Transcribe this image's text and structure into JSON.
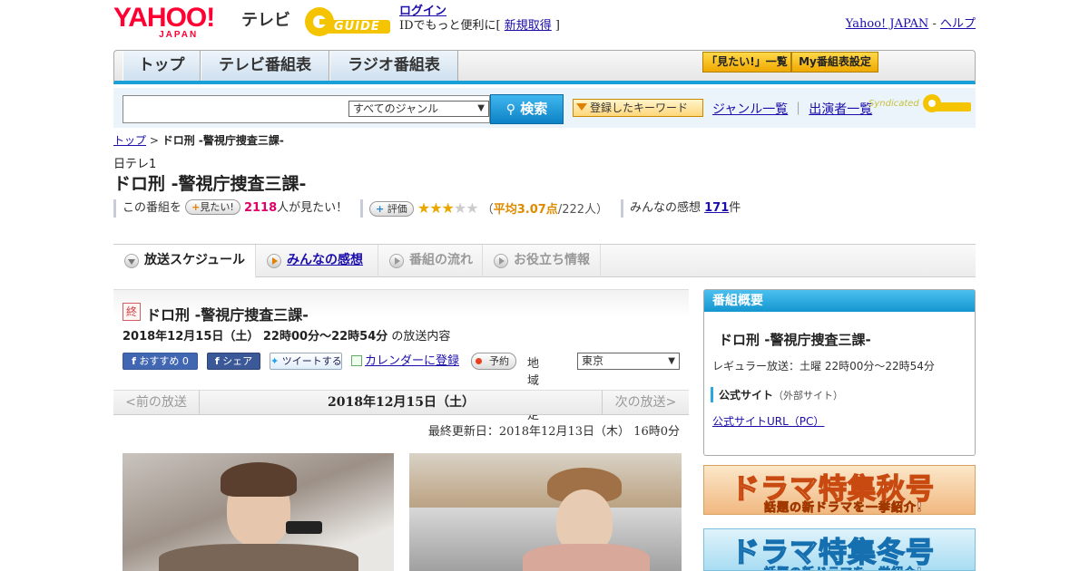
{
  "header": {
    "logo_yahoo": "YAHOO!",
    "logo_japan": "JAPAN",
    "logo_tv": "テレビ",
    "logo_gguide": "GUIDE",
    "login_label": "ログイン",
    "login_note_prefix": "IDでもっと便利に[ ",
    "register_label": "新規取得",
    "login_note_suffix": " ]",
    "yahoo_japan_link": "Yahoo! JAPAN",
    "separator": " - ",
    "help_link": "ヘルプ"
  },
  "nav": {
    "tabs": [
      {
        "label": "トップ"
      },
      {
        "label": "テレビ番組表"
      },
      {
        "label": "ラジオ番組表"
      }
    ],
    "want_list_label": "「見たい!」一覧",
    "my_program_label": "My番組表設定"
  },
  "search": {
    "placeholder": "",
    "genre_selected": "すべてのジャンル",
    "search_button": "検索",
    "keyword_button": "登録したキーワード",
    "genre_list_link": "ジャンル一覧",
    "link_separator": "｜",
    "performer_list_link": "出演者一覧",
    "syndicated_label": "Syndicated"
  },
  "breadcrumb": {
    "top_link": "トップ",
    "separator": " > ",
    "current": "ドロ刑 -警視庁捜査三課-"
  },
  "program": {
    "channel": "日テレ1",
    "title": "ドロ刑 -警視庁捜査三課-",
    "want_prefix": "この番組を",
    "want_button": "見たい!",
    "want_count": "2118",
    "want_suffix": "人が見たい！",
    "rate_button": "評価",
    "rating_stars": 3,
    "rating_paren_open": "（",
    "rating_avg": "平均3.07点",
    "rating_count": "/222人）",
    "impressions_prefix": "みんなの感想 ",
    "impressions_count": "171",
    "impressions_suffix": "件"
  },
  "content_tabs": [
    {
      "label": "放送スケジュール",
      "state": "active"
    },
    {
      "label": "みんなの感想",
      "state": "link"
    },
    {
      "label": "番組の流れ",
      "state": "disabled"
    },
    {
      "label": "お役立ち情報",
      "state": "disabled"
    }
  ],
  "broadcast": {
    "end_badge": "終",
    "title": "ドロ刑 -警視庁捜査三課-",
    "datetime": "2018年12月15日（土） 22時00分～22時54分",
    "datetime_suffix": " の放送内容",
    "fb_recommend": "おすすめ 0",
    "fb_share": "シェア",
    "tweet": "ツイートする",
    "calendar_link": "カレンダーに登録",
    "reserve": "予約",
    "region_label": "地域設定",
    "region_selected": "東京"
  },
  "date_nav": {
    "prev": "<前の放送",
    "current": "2018年12月15日（土）",
    "next": "次の放送>"
  },
  "last_updated": "最終更新日：2018年12月13日（木） 16時0分",
  "sidebar": {
    "heading": "番組概要",
    "title": "ドロ刑 -警視庁捜査三課-",
    "regular": "レギュラー放送：土曜 22時00分～22時54分",
    "official_label": "公式サイト",
    "official_note": "（外部サイト）",
    "official_url_link": "公式サイトURL（PC）"
  },
  "banners": [
    {
      "title": "ドラマ特集秋号",
      "sub": "話題の新ドラマを一挙紹介!"
    },
    {
      "title": "ドラマ特集冬号",
      "sub": "話題の新ドラマを一挙紹介!"
    }
  ],
  "colors": {
    "accent_blue": "#1aa0d8",
    "yahoo_red": "#ff0033",
    "want_count_pink": "#e0006a",
    "rating_orange": "#e08a00"
  }
}
